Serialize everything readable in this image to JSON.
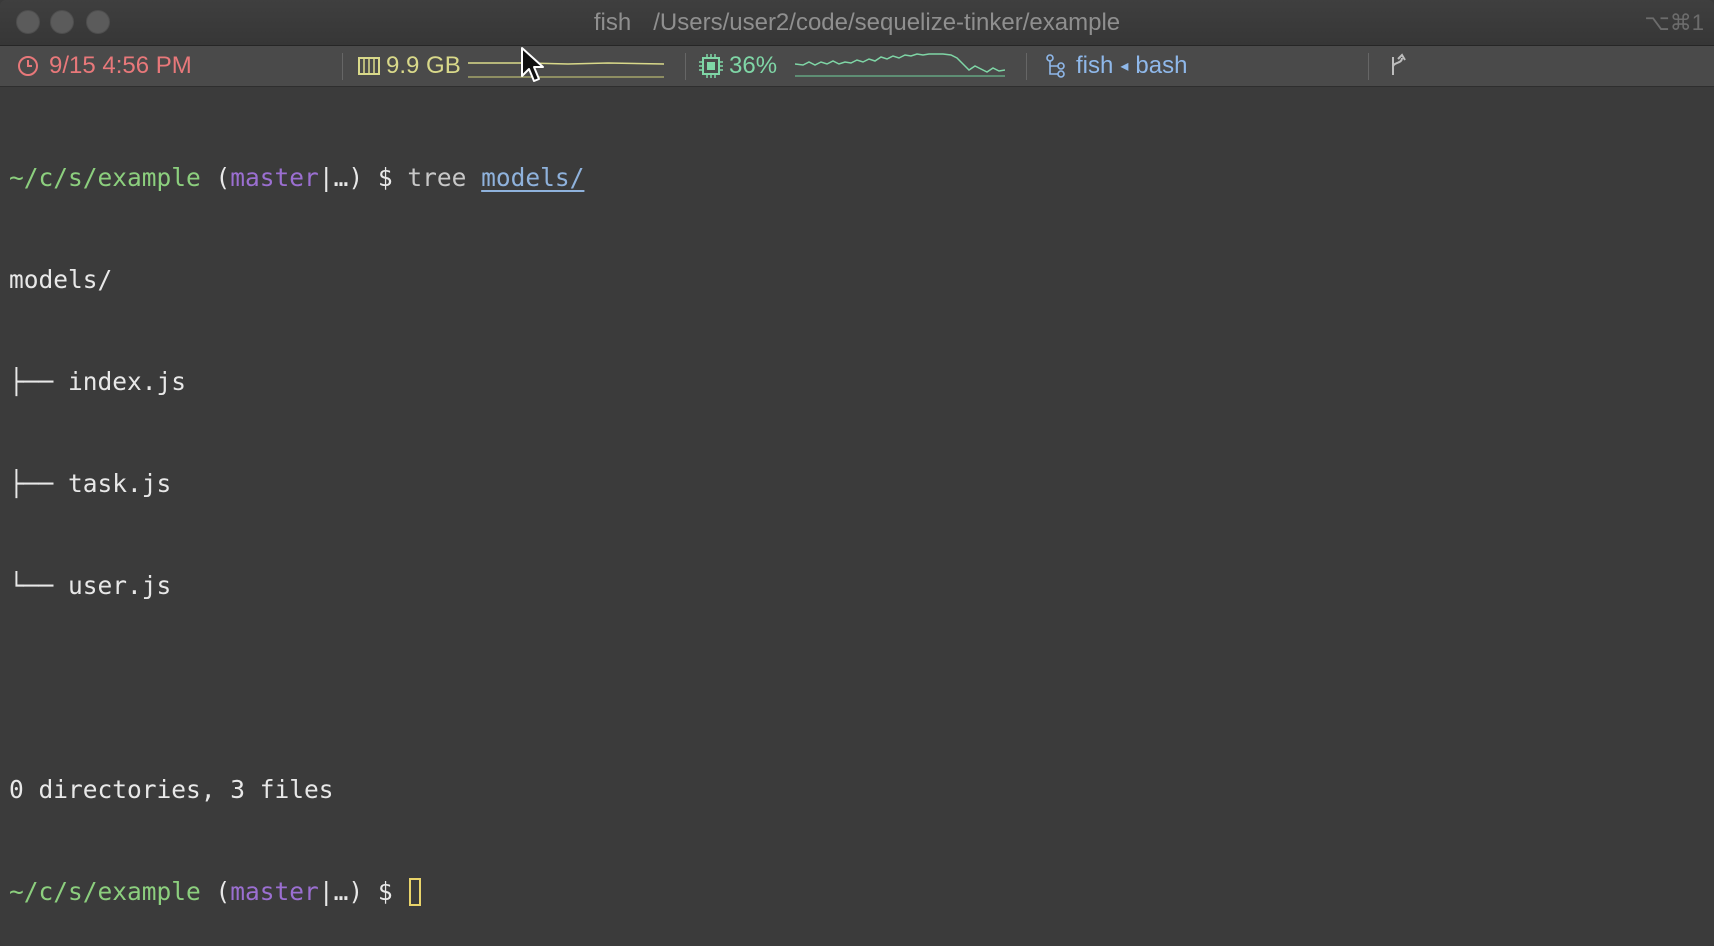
{
  "window": {
    "title_shell": "fish",
    "title_path": "/Users/user2/code/sequelize-tinker/example",
    "shortcut": "⌥⌘1"
  },
  "statusbar": {
    "clock": {
      "icon": "clock-icon",
      "text": "9/15 4:56 PM",
      "color": "#e8787a"
    },
    "memory": {
      "icon": "memory-chip-icon",
      "text": "9.9 GB",
      "color": "#d9d98a"
    },
    "cpu": {
      "icon": "cpu-icon",
      "text": "36%",
      "color": "#7fd6a6"
    },
    "jobs": {
      "icon": "process-tree-icon",
      "current": "fish",
      "separator": "◂",
      "parent": "bash",
      "color": "#8fb8ea"
    },
    "git": {
      "icon": "git-branch-icon"
    }
  },
  "terminal": {
    "prompt_path": "~/c/s/example",
    "prompt_open": "(",
    "prompt_branch": "master",
    "prompt_status": "|…)",
    "prompt_symbol": "$",
    "command": "tree",
    "command_arg": "models/",
    "output_root": "models/",
    "tree_items": [
      {
        "branch": "├── ",
        "name": "index.js"
      },
      {
        "branch": "├── ",
        "name": "task.js"
      },
      {
        "branch": "└── ",
        "name": "user.js"
      }
    ],
    "summary": "0 directories, 3 files"
  }
}
